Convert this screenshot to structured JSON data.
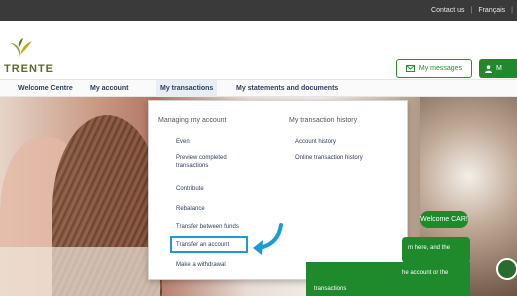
{
  "topbar": {
    "contact_label": "Contact us",
    "language_label": "Français",
    "separator": "|"
  },
  "header": {
    "logo_text": "TRENTE",
    "messages_button": "My messages",
    "my_button": "M"
  },
  "nav": {
    "items": [
      {
        "label": "Welcome Centre"
      },
      {
        "label": "My account"
      },
      {
        "label": "My transactions"
      },
      {
        "label": "My statements and documents"
      }
    ],
    "active_index": 2
  },
  "dropdown": {
    "col1_heading": "Managing my account",
    "col1_items": [
      {
        "label": "Even"
      },
      {
        "label": "Preview completed transactions"
      },
      {
        "label": "Contribute"
      },
      {
        "label": "Rebalance"
      },
      {
        "label": "Transfer between funds"
      },
      {
        "label": "Transfer an account"
      },
      {
        "label": "Make a withdrawal"
      }
    ],
    "col2_heading": "My transaction history",
    "col2_items": [
      {
        "label": "Account history"
      },
      {
        "label": "Online transaction history"
      }
    ],
    "highlighted_item": "Transfer an account"
  },
  "chat": {
    "welcome": "Welcome CAR!",
    "bubble1": "m here, and the",
    "bubble2_line1": "he account or the",
    "bubble2_line2": "transactions"
  },
  "colors": {
    "brand_green": "#1f8a2c",
    "nav_text": "#2f3f5f",
    "highlight_blue": "#1a9ad6",
    "topbar": "#3a3a3a"
  }
}
